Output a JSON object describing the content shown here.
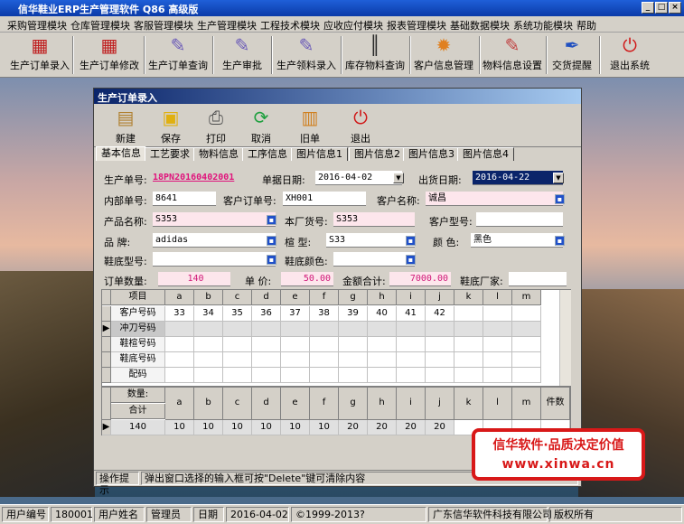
{
  "app": {
    "title": "信华鞋业ERP生产管理软件  Q86 高级版"
  },
  "menu": [
    "采购管理模块",
    "仓库管理模块",
    "客服管理模块",
    "生产管理模块",
    "工程技术模块",
    "应收应付模块",
    "报表管理模块",
    "基础数据模块",
    "系统功能模块",
    "帮助"
  ],
  "toolbar": [
    "生产订单录入",
    "生产订单修改",
    "生产订单查询",
    "生产审批",
    "生产领料录入",
    "库存物料查询",
    "客户信息管理",
    "物料信息设置",
    "交货提醒",
    "退出系统"
  ],
  "icons": {
    "toolbar": [
      "pdf-icon",
      "pdf-icon",
      "feather-icon",
      "feather-icon",
      "feather-icon",
      "barcode-icon",
      "gear-icon",
      "feather-icon",
      "pen-icon",
      "exit-icon"
    ]
  },
  "window": {
    "title": "生产订单录入",
    "tools": [
      "新建",
      "保存",
      "打印",
      "取消",
      "旧单",
      "退出"
    ],
    "tabs": [
      "基本信息",
      "工艺要求",
      "物料信息",
      "工序信息",
      "图片信息1",
      "图片信息2",
      "图片信息3",
      "图片信息4"
    ]
  },
  "form": {
    "order_no_label": "生产单号:",
    "order_no": "18PN20160402001",
    "doc_date_label": "单据日期:",
    "doc_date": "2016-04-02",
    "ship_date_label": "出货日期:",
    "ship_date": "2016-04-22",
    "internal_no_label": "内部单号:",
    "internal_no": "8641",
    "cust_order_label": "客户订单号:",
    "cust_order": "XH001",
    "cust_name_label": "客户名称:",
    "cust_name": "诚昌",
    "product_label": "产品名称:",
    "product": "S353",
    "factory_no_label": "本厂货号:",
    "factory_no": "S353",
    "cust_model_label": "客户型号:",
    "cust_model": "",
    "brand_label": "品  牌:",
    "brand": "adidas",
    "last_label": "楦  型:",
    "last": "S33",
    "color_label": "颜  色:",
    "color": "黑色",
    "sole_model_label": "鞋底型号:",
    "sole_model": "",
    "sole_color_label": "鞋底颜色:",
    "sole_color": "",
    "qty_label": "订单数量:",
    "qty": "140",
    "price_label": "单  价:",
    "price": "50.00",
    "amount_label": "金额合计:",
    "amount": "7000.00",
    "sole_vendor_label": "鞋底厂家:",
    "sole_vendor": ""
  },
  "grid": {
    "header": [
      "项目",
      "a",
      "b",
      "c",
      "d",
      "e",
      "f",
      "g",
      "h",
      "i",
      "j",
      "k",
      "l",
      "m"
    ],
    "rows": [
      {
        "label": "客户号码",
        "values": [
          "33",
          "34",
          "35",
          "36",
          "37",
          "38",
          "39",
          "40",
          "41",
          "42",
          "",
          "",
          ""
        ]
      },
      {
        "label": "冲刀号码",
        "values": [
          "",
          "",
          "",
          "",
          "",
          "",
          "",
          "",
          "",
          "",
          "",
          "",
          ""
        ]
      },
      {
        "label": "鞋楦号码",
        "values": [
          "",
          "",
          "",
          "",
          "",
          "",
          "",
          "",
          "",
          "",
          "",
          "",
          ""
        ]
      },
      {
        "label": "鞋底号码",
        "values": [
          "",
          "",
          "",
          "",
          "",
          "",
          "",
          "",
          "",
          "",
          "",
          "",
          ""
        ]
      },
      {
        "label": "配码",
        "values": [
          "",
          "",
          "",
          "",
          "",
          "",
          "",
          "",
          "",
          "",
          "",
          "",
          ""
        ]
      }
    ]
  },
  "grid2": {
    "qty_label": "数量:",
    "total_label": "合计",
    "header": [
      "a",
      "b",
      "c",
      "d",
      "e",
      "f",
      "g",
      "h",
      "i",
      "j",
      "k",
      "l",
      "m",
      "件数"
    ],
    "total": "140",
    "values": [
      "10",
      "10",
      "10",
      "10",
      "10",
      "10",
      "20",
      "20",
      "20",
      "20",
      "",
      "",
      "",
      ""
    ]
  },
  "hint": {
    "label": "操作提示",
    "text": "弹出窗口选择的输入框可按\"Delete\"键可清除内容"
  },
  "watermark": {
    "line1": "信华软件·品质决定价值",
    "line2": "www.xinwa.cn"
  },
  "status": {
    "user_no_label": "用户编号",
    "user_no": "180001",
    "user_name_label": "用户姓名",
    "user_name": "管理员",
    "date_label": "日期",
    "date": "2016-04-02",
    "copyright": "©1999-2013?",
    "company": "广东信华软件科技有限公司",
    "rights": "版权所有"
  }
}
